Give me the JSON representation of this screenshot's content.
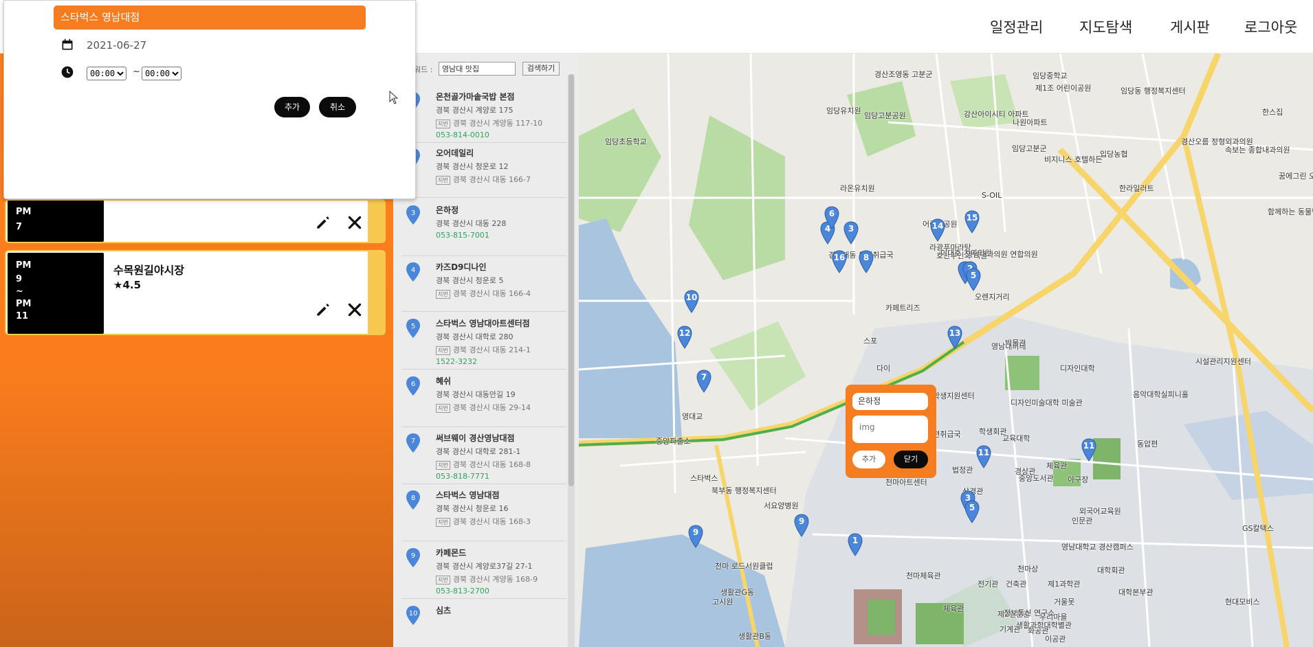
{
  "nav": {
    "schedule": "일정관리",
    "map_search": "지도탐색",
    "board": "게시판",
    "logout": "로그아웃"
  },
  "popup": {
    "place_name": "스타벅스 영남대점",
    "date": "2021-06-27",
    "start_time": "00:00",
    "end_time": "00:00",
    "separator": "~",
    "add_label": "추가",
    "cancel_label": "취소",
    "icons": [
      "calendar-icon",
      "clock-icon"
    ]
  },
  "schedule_cards": [
    {
      "time_lines": [
        "PM",
        "7"
      ],
      "title": "",
      "rating": ""
    },
    {
      "time_lines": [
        "PM",
        "9",
        "~",
        "PM",
        "11"
      ],
      "title": "수목원길야시장",
      "rating": "★4.5"
    }
  ],
  "search": {
    "keyword_label": "워드 :",
    "query": "영남대 맛집",
    "button": "검색하기"
  },
  "results": [
    {
      "no": "1",
      "name": "온천골가마솥국밥 본점",
      "road": "경북 경산시 계양로 175",
      "jibun": "경북 경산시 계양동 117-10",
      "phone": "053-814-0010"
    },
    {
      "no": "2",
      "name": "오어데일리",
      "road": "경북 경산시 청운로 12",
      "jibun": "경북 경산시 대동 166-7",
      "phone": ""
    },
    {
      "no": "3",
      "name": "은하정",
      "road": "경북 경산시 대동 228",
      "jibun": "",
      "phone": "053-815-7001"
    },
    {
      "no": "4",
      "name": "카즈D9디나인",
      "road": "경북 경산시 청운로 5",
      "jibun": "경북 경산시 대동 166-4",
      "phone": ""
    },
    {
      "no": "5",
      "name": "스타벅스 영남대아트센터점",
      "road": "경북 경산시 대학로 280",
      "jibun": "경북 경산시 대동 214-1",
      "phone": "1522-3232"
    },
    {
      "no": "6",
      "name": "혜쉬",
      "road": "경북 경산시 대동안길 19",
      "jibun": "경북 경산시 대동 29-14",
      "phone": ""
    },
    {
      "no": "7",
      "name": "써브웨이 경산영남대점",
      "road": "경북 경산시 대학로 281-1",
      "jibun": "경북 경산시 대동 168-8",
      "phone": "053-818-7771"
    },
    {
      "no": "8",
      "name": "스타벅스 영남대점",
      "road": "경북 경산시 청운로 16",
      "jibun": "경북 경산시 대동 168-3",
      "phone": ""
    },
    {
      "no": "9",
      "name": "카페몬드",
      "road": "경북 경산시 계양로37길 27-1",
      "jibun": "경북 경산시 계양동 168-9",
      "phone": "053-813-2700"
    },
    {
      "no": "10",
      "name": "심츠",
      "road": "",
      "jibun": "",
      "phone": ""
    }
  ],
  "jibun_tag": "지번",
  "map": {
    "labels": [
      "경산조영동 고분군",
      "임당중학교",
      "임당고분공원",
      "임당유치원",
      "제1조 어린이공원",
      "임당동 행정복지센터",
      "강산아이시티 아파트",
      "나원아파트",
      "임당고분군",
      "라온유치원",
      "비지니스 호텔하든",
      "입당농협",
      "임당초등학교",
      "어린이공원",
      "라광푸마라탕",
      "호산부인과 의원",
      "이대호 치과의원",
      "S-OIL",
      "경산대동 우편취급국",
      "카페트리즈",
      "영남내과의원 연합의원",
      "오렌지거리",
      "스포",
      "다이",
      "영남대미네",
      "박물관",
      "시설관리지원센터",
      "음악대학실피니홀",
      "디자인미술대학 미술관",
      "학생지원센터",
      "우편취급국",
      "학생회관",
      "교육대학",
      "천마아트센터",
      "영남대학교 경산캠퍼스",
      "외국어교육원",
      "중앙도서관",
      "아구장",
      "스타벅스",
      "북부동 행정복지센터",
      "천마 로드서원클럽",
      "서요양병원",
      "천마체육관",
      "체육관",
      "제1과학관",
      "대학본부관",
      "현대모비스",
      "GS칼텍스",
      "경산오름 정형외과의원",
      "속보는 종합내과의원",
      "꿈에그린 오피스텔",
      "함께하는 동물병원",
      "한라일러트",
      "한스집",
      "생활과학대학별관",
      "중앙파출소",
      "거울못",
      "천마상",
      "전기관",
      "건축관",
      "우리마을",
      "기계관",
      "인문관",
      "상경관",
      "법정관",
      "제2인문관",
      "생활관G동",
      "고시원",
      "생활관B동",
      "화공관",
      "이공관",
      "체육관",
      "동압편",
      "영대교",
      "디자인대학",
      "경상관",
      "대학회관",
      "정보통신 연구소"
    ],
    "pins": [
      "1",
      "2",
      "3",
      "4",
      "5",
      "6",
      "7",
      "8",
      "9",
      "10",
      "11",
      "12",
      "13",
      "14",
      "15",
      "16",
      "1",
      "3",
      "5",
      "9",
      "11"
    ],
    "infowindow": {
      "name": "은하정",
      "img_placeholder": "img",
      "add_label": "추가",
      "close_label": "닫기"
    }
  },
  "colors": {
    "accent_orange": "#f57c1f",
    "card_yellow": "#f6c94e",
    "pin_blue": "#4a86d9",
    "phone_green": "#2fa35b"
  }
}
